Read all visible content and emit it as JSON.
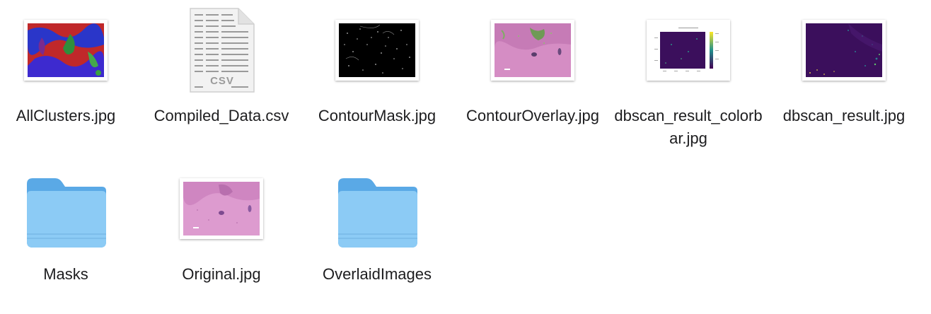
{
  "window": {
    "view": "icon-view"
  },
  "files": [
    {
      "name": "AllClusters.jpg",
      "kind": "image",
      "icon": "clusters-thumbnail-icon"
    },
    {
      "name": "Compiled_Data.csv",
      "kind": "csv",
      "icon": "csv-document-icon",
      "badge": "CSV"
    },
    {
      "name": "ContourMask.jpg",
      "kind": "image",
      "icon": "contour-mask-thumbnail-icon"
    },
    {
      "name": "ContourOverlay.jpg",
      "kind": "image",
      "icon": "contour-overlay-thumbnail-icon"
    },
    {
      "name": "dbscan_result_colorbar.jpg",
      "kind": "image",
      "icon": "chart-thumbnail-icon"
    },
    {
      "name": "dbscan_result.jpg",
      "kind": "image",
      "icon": "dbscan-thumbnail-icon"
    },
    {
      "name": "Masks",
      "kind": "folder",
      "icon": "folder-icon"
    },
    {
      "name": "Original.jpg",
      "kind": "image",
      "icon": "tissue-thumbnail-icon"
    },
    {
      "name": "OverlaidImages",
      "kind": "folder",
      "icon": "folder-icon"
    }
  ],
  "colors": {
    "folder_front": "#8ccbf5",
    "folder_back": "#5aa9e6",
    "folder_tab": "#4f9fdf",
    "tissue_pink": "#d891c8",
    "dbscan_purple": "#3b0f5c"
  }
}
